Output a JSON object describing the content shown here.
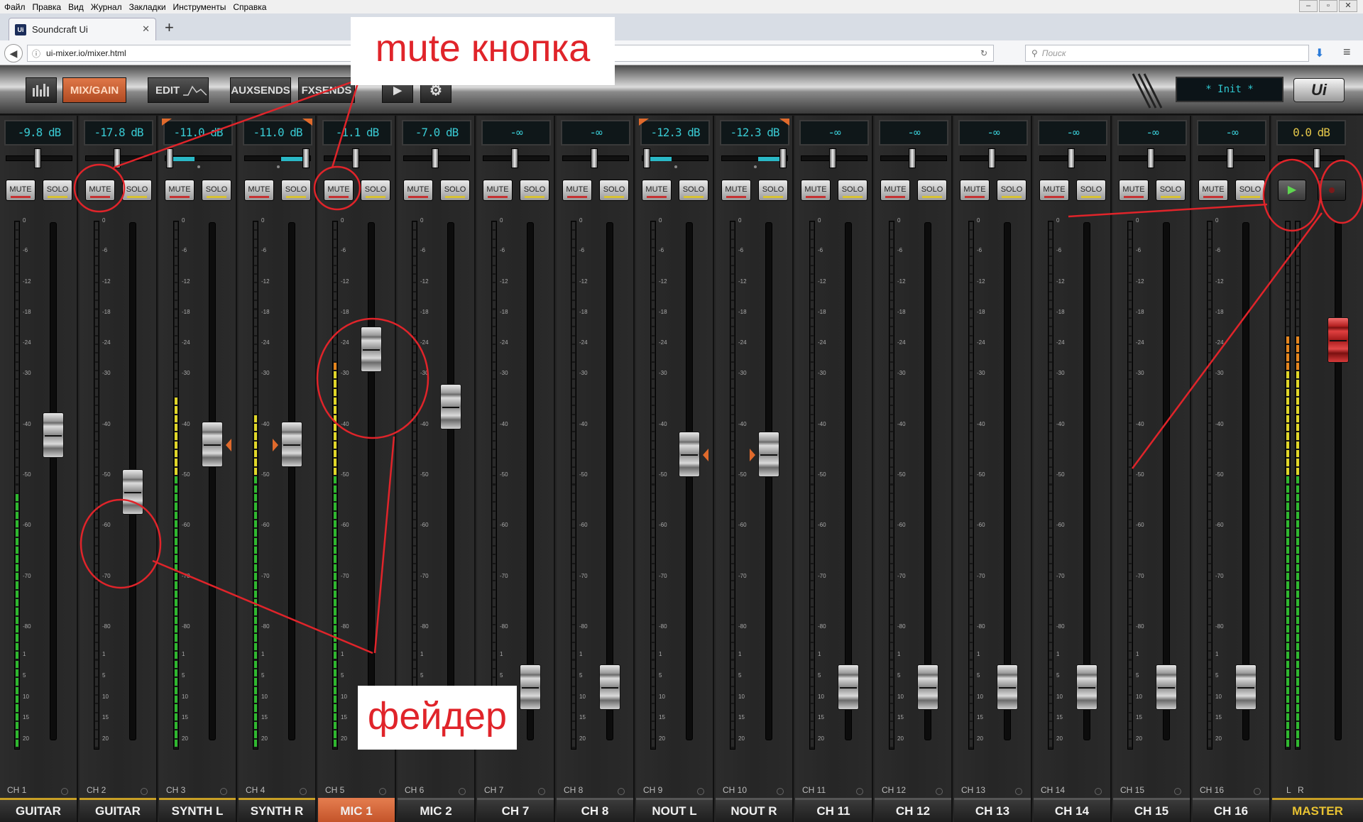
{
  "browser": {
    "menu": [
      "Файл",
      "Правка",
      "Вид",
      "Журнал",
      "Закладки",
      "Инструменты",
      "Справка"
    ],
    "tab_title": "Soundcraft Ui",
    "tab_icon": "Ui",
    "url": "ui-mixer.io/mixer.html",
    "search_placeholder": "Поиск"
  },
  "toolbar": {
    "mix_gain_label": "MIX/GAIN",
    "edit_label": "EDIT",
    "aux_sends_label": "AUXSENDS",
    "fx_sends_label": "FXSENDS",
    "scene": "* Init *",
    "logo": "Ui"
  },
  "buttons": {
    "mute": "MUTE",
    "solo": "SOLO"
  },
  "meter_scale": [
    "0",
    "-6",
    "-12",
    "-18",
    "-24",
    "-30",
    "-40",
    "-50",
    "-60",
    "-70",
    "-80",
    "1",
    "5",
    "10",
    "15",
    "20"
  ],
  "channels": [
    {
      "ch": "CH 1",
      "name": "GUITAR",
      "db": "-9.8 dB",
      "fader": 0.4,
      "meter": 0.48,
      "bar": "gold",
      "pan": null
    },
    {
      "ch": "CH 2",
      "name": "GUITAR",
      "db": "-17.8 dB",
      "fader": 0.52,
      "meter": 0.0,
      "bar": "gold",
      "pan": null
    },
    {
      "ch": "CH 3",
      "name": "SYNTH L",
      "db": "-11.0 dB",
      "fader": 0.42,
      "meter": 0.66,
      "bar": "gold",
      "pan": "L",
      "gain": "L"
    },
    {
      "ch": "CH 4",
      "name": "SYNTH R",
      "db": "-11.0 dB",
      "fader": 0.42,
      "meter": 0.62,
      "bar": "gold",
      "pan": "R",
      "gain": "R"
    },
    {
      "ch": "CH 5",
      "name": "MIC 1",
      "db": "-1.1 dB",
      "fader": 0.22,
      "meter": 0.73,
      "bar": "orange",
      "pan": null
    },
    {
      "ch": "CH 6",
      "name": "MIC 2",
      "db": "-7.0 dB",
      "fader": 0.34,
      "meter": 0.0,
      "bar": "plain",
      "pan": null
    },
    {
      "ch": "CH 7",
      "name": "CH 7",
      "db": "-∞",
      "fader": 0.93,
      "meter": 0.0,
      "bar": "plain",
      "pan": null
    },
    {
      "ch": "CH 8",
      "name": "CH 8",
      "db": "-∞",
      "fader": 0.93,
      "meter": 0.0,
      "bar": "plain",
      "pan": null
    },
    {
      "ch": "CH 9",
      "name": "NOUT L",
      "db": "-12.3 dB",
      "fader": 0.44,
      "meter": 0.0,
      "bar": "plain",
      "pan": "L",
      "gain": "L"
    },
    {
      "ch": "CH 10",
      "name": "NOUT R",
      "db": "-12.3 dB",
      "fader": 0.44,
      "meter": 0.0,
      "bar": "plain",
      "pan": "R",
      "gain": "R"
    },
    {
      "ch": "CH 11",
      "name": "CH 11",
      "db": "-∞",
      "fader": 0.93,
      "meter": 0.0,
      "bar": "plain",
      "pan": null
    },
    {
      "ch": "CH 12",
      "name": "CH 12",
      "db": "-∞",
      "fader": 0.93,
      "meter": 0.0,
      "bar": "plain",
      "pan": null
    },
    {
      "ch": "CH 13",
      "name": "CH 13",
      "db": "-∞",
      "fader": 0.93,
      "meter": 0.0,
      "bar": "plain",
      "pan": null
    },
    {
      "ch": "CH 14",
      "name": "CH 14",
      "db": "-∞",
      "fader": 0.93,
      "meter": 0.0,
      "bar": "plain",
      "pan": null
    },
    {
      "ch": "CH 15",
      "name": "CH 15",
      "db": "-∞",
      "fader": 0.93,
      "meter": 0.0,
      "bar": "plain",
      "pan": null
    },
    {
      "ch": "CH 16",
      "name": "CH 16",
      "db": "-∞",
      "fader": 0.93,
      "meter": 0.0,
      "bar": "plain",
      "pan": null
    }
  ],
  "master": {
    "ch_l": "L",
    "ch_r": "R",
    "name": "MASTER",
    "db": "0.0 dB",
    "fader": 0.2,
    "meter": 0.78
  },
  "annotations": {
    "mute_label": "mute кнопка",
    "fader_label": "фейдер"
  },
  "colors": {
    "accent_orange": "#e27a4c",
    "display_cyan": "#39c9d2",
    "annotation_red": "#e0242a",
    "meter_green": "#2fb82f",
    "meter_yellow": "#e0d628",
    "meter_orange": "#e6861e"
  }
}
